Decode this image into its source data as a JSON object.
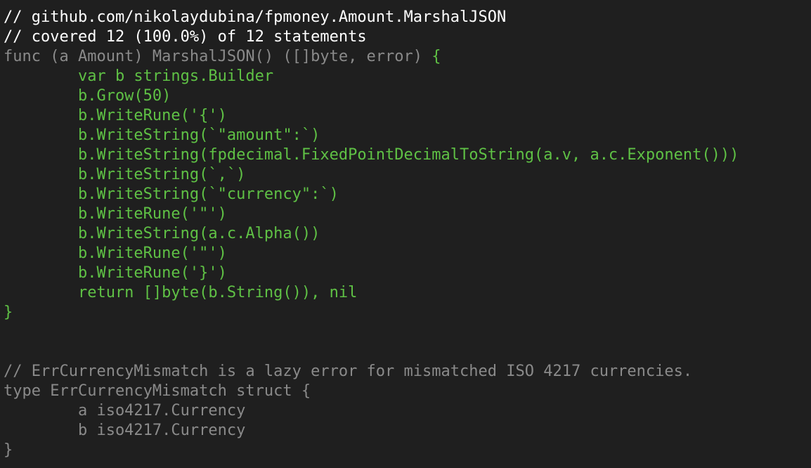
{
  "coverage_view": {
    "header": [
      "// github.com/nikolaydubina/fpmoney.Amount.MarshalJSON",
      "// covered 12 (100.0%) of 12 statements"
    ],
    "func_signature": "func (a Amount) MarshalJSON() ([]byte, error) ",
    "func_open_brace": "{",
    "body_lines": [
      "        var b strings.Builder",
      "        b.Grow(50)",
      "        b.WriteRune('{')",
      "        b.WriteString(`\"amount\":`)",
      "        b.WriteString(fpdecimal.FixedPointDecimalToString(a.v, a.c.Exponent()))",
      "        b.WriteString(`,`)",
      "        b.WriteString(`\"currency\":`)",
      "        b.WriteRune('\"')",
      "        b.WriteString(a.c.Alpha())",
      "        b.WriteRune('\"')",
      "        b.WriteRune('}')",
      "        return []byte(b.String()), nil"
    ],
    "func_close_brace": "}",
    "after_lines": [
      "// ErrCurrencyMismatch is a lazy error for mismatched ISO 4217 currencies.",
      "type ErrCurrencyMismatch struct {",
      "        a iso4217.Currency",
      "        b iso4217.Currency",
      "}"
    ],
    "colors": {
      "background": "#1f1f1f",
      "header": "#ffffff",
      "covered": "#5fc145",
      "uncovered": "#8a8a8a"
    }
  }
}
